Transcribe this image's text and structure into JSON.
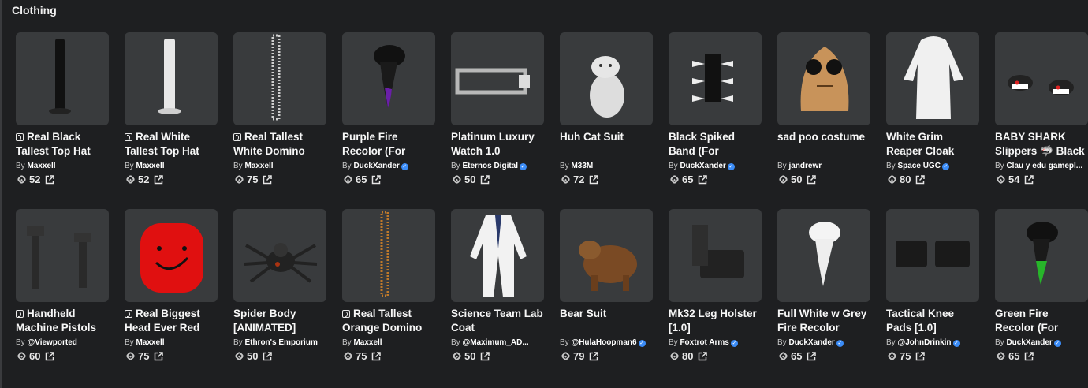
{
  "section": {
    "title": "Clothing"
  },
  "items": [
    {
      "name": "Real Black Tallest Top Hat",
      "limited": true,
      "creator_prefix": "By",
      "creator": "Maxxell",
      "verified": false,
      "price": "52",
      "thumb_icon": "black-tall-hat-thumbnail"
    },
    {
      "name": "Real White Tallest Top Hat",
      "limited": true,
      "creator_prefix": "By",
      "creator": "Maxxell",
      "verified": false,
      "price": "52",
      "thumb_icon": "white-tall-hat-thumbnail"
    },
    {
      "name": "Real Tallest White Domino",
      "limited": true,
      "creator_prefix": "By",
      "creator": "Maxxell",
      "verified": false,
      "price": "75",
      "thumb_icon": "white-domino-thumbnail"
    },
    {
      "name": "Purple Fire Recolor (For",
      "limited": false,
      "creator_prefix": "By",
      "creator": "DuckXander",
      "verified": true,
      "price": "65",
      "thumb_icon": "purple-fire-hair-thumbnail"
    },
    {
      "name": "Platinum Luxury Watch 1.0",
      "limited": false,
      "creator_prefix": "By",
      "creator": "Eternos Digital",
      "verified": true,
      "price": "50",
      "thumb_icon": "watch-thumbnail"
    },
    {
      "name": "Huh Cat Suit",
      "limited": false,
      "creator_prefix": "By",
      "creator": "M33M",
      "verified": false,
      "price": "72",
      "thumb_icon": "cat-suit-thumbnail"
    },
    {
      "name": "Black Spiked Band (For",
      "limited": false,
      "creator_prefix": "By",
      "creator": "DuckXander",
      "verified": true,
      "price": "65",
      "thumb_icon": "spiked-band-thumbnail"
    },
    {
      "name": "sad poo costume",
      "limited": false,
      "creator_prefix": "By",
      "creator": "jandrewr",
      "verified": false,
      "price": "50",
      "thumb_icon": "poo-costume-thumbnail"
    },
    {
      "name": "White Grim Reaper Cloak",
      "limited": false,
      "creator_prefix": "By",
      "creator": "Space UGC",
      "verified": true,
      "price": "80",
      "thumb_icon": "reaper-cloak-thumbnail"
    },
    {
      "name": "BABY SHARK Slippers 🦈 Black",
      "limited": false,
      "creator_prefix": "By",
      "creator": "Clau y edu gamepl...",
      "verified": false,
      "price": "54",
      "thumb_icon": "shark-slippers-thumbnail"
    },
    {
      "name": "Handheld Machine Pistols",
      "limited": true,
      "creator_prefix": "By",
      "creator": "@Viewported",
      "verified": false,
      "price": "60",
      "thumb_icon": "pistols-thumbnail"
    },
    {
      "name": "Real Biggest Head Ever Red",
      "limited": true,
      "creator_prefix": "By",
      "creator": "Maxxell",
      "verified": false,
      "price": "75",
      "thumb_icon": "red-head-thumbnail"
    },
    {
      "name": "Spider Body [ANIMATED]",
      "limited": false,
      "creator_prefix": "By",
      "creator": "Ethron's Emporium",
      "verified": false,
      "price": "50",
      "thumb_icon": "spider-thumbnail"
    },
    {
      "name": "Real Tallest Orange Domino",
      "limited": true,
      "creator_prefix": "By",
      "creator": "Maxxell",
      "verified": false,
      "price": "75",
      "thumb_icon": "orange-domino-thumbnail"
    },
    {
      "name": "Science Team Lab Coat",
      "limited": false,
      "creator_prefix": "By",
      "creator": "@Maximum_AD...",
      "verified": false,
      "price": "50",
      "thumb_icon": "lab-coat-thumbnail"
    },
    {
      "name": "Bear Suit",
      "limited": false,
      "creator_prefix": "By",
      "creator": "@HulaHoopman6",
      "verified": true,
      "price": "79",
      "thumb_icon": "bear-suit-thumbnail"
    },
    {
      "name": "Mk32 Leg Holster [1.0]",
      "limited": false,
      "creator_prefix": "By",
      "creator": "Foxtrot Arms",
      "verified": true,
      "price": "80",
      "thumb_icon": "leg-holster-thumbnail"
    },
    {
      "name": "Full White w Grey Fire Recolor",
      "limited": false,
      "creator_prefix": "By",
      "creator": "DuckXander",
      "verified": true,
      "price": "65",
      "thumb_icon": "white-fire-hair-thumbnail"
    },
    {
      "name": "Tactical Knee Pads [1.0]",
      "limited": false,
      "creator_prefix": "By",
      "creator": "@JohnDrinkin",
      "verified": true,
      "price": "75",
      "thumb_icon": "knee-pads-thumbnail"
    },
    {
      "name": "Green Fire Recolor (For",
      "limited": false,
      "creator_prefix": "By",
      "creator": "DuckXander",
      "verified": true,
      "price": "65",
      "thumb_icon": "green-fire-hair-thumbnail"
    }
  ]
}
